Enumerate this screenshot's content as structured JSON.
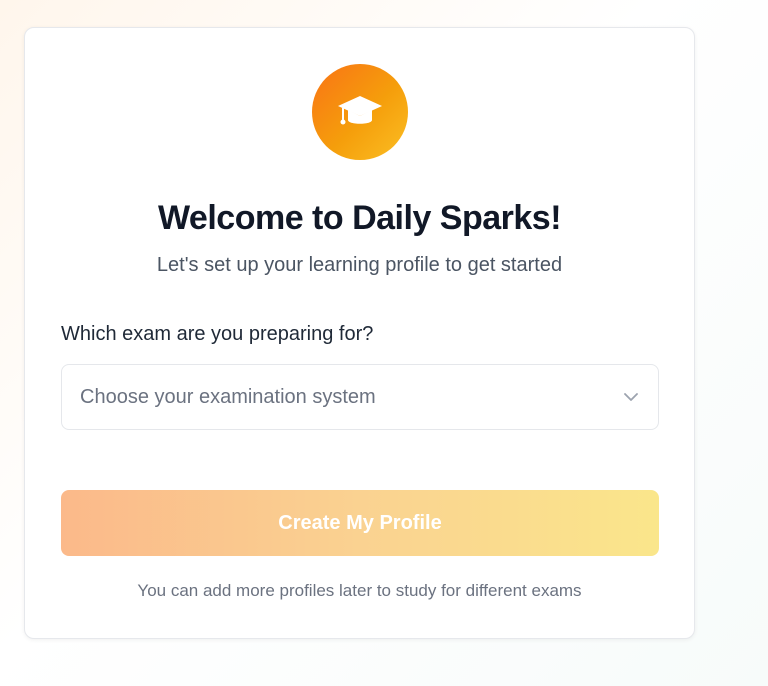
{
  "onboarding": {
    "logo_icon": "graduation-cap-icon",
    "title": "Welcome to Daily Sparks!",
    "subtitle": "Let's set up your learning profile to get started",
    "exam_label": "Which exam are you preparing for?",
    "exam_select": {
      "placeholder": "Choose your examination system",
      "chevron_icon": "chevron-down-icon"
    },
    "create_button": "Create My Profile",
    "footnote": "You can add more profiles later to study for different exams"
  },
  "colors": {
    "accent_start": "#f97316",
    "accent_end": "#fbbf24",
    "title": "#111827",
    "muted_text": "#6b7280"
  }
}
